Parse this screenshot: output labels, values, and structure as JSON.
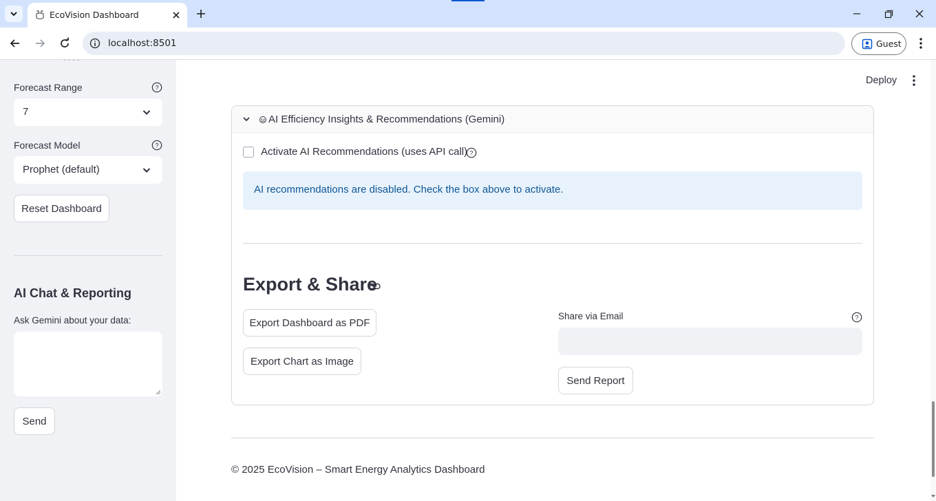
{
  "browser": {
    "tab_title": "EcoVision Dashboard",
    "url": "localhost:8501",
    "profile_label": "Guest",
    "icons": [
      "tab-list-icon",
      "favicon-icon",
      "close-icon",
      "plus-icon",
      "minimize-icon",
      "maximize-icon",
      "close-window-icon",
      "back-icon",
      "forward-icon",
      "reload-icon",
      "site-info-icon",
      "profile-icon",
      "kebab-menu-icon"
    ]
  },
  "sidebar": {
    "forecast_range": {
      "label": "Forecast Range",
      "value": "7"
    },
    "forecast_model": {
      "label": "Forecast Model",
      "value": "Prophet (default)"
    },
    "reset_button": "Reset Dashboard",
    "chat_heading": "AI Chat & Reporting",
    "chat_label": "Ask Gemini about your data:",
    "chat_value": "",
    "send_button": "Send"
  },
  "header": {
    "deploy_label": "Deploy"
  },
  "expander": {
    "title": "AI Efficiency Insights & Recommendations (Gemini)",
    "checkbox_label": "Activate AI Recommendations (uses API call)",
    "checkbox_checked": false,
    "info_message": "AI recommendations are disabled. Check the box above to activate."
  },
  "export": {
    "title": "Export & Share",
    "pdf_button": "Export Dashboard as PDF",
    "image_button": "Export Chart as Image",
    "email_label": "Share via Email",
    "email_value": "",
    "send_report_button": "Send Report"
  },
  "footer": {
    "text": "© 2025 EcoVision – Smart Energy Analytics Dashboard"
  },
  "colors": {
    "tabbar_bg": "#d3e3fd",
    "sidebar_bg": "#f0f2f6",
    "info_bg": "#e8f2fc",
    "info_text": "#0f5795",
    "text": "#31333f"
  }
}
